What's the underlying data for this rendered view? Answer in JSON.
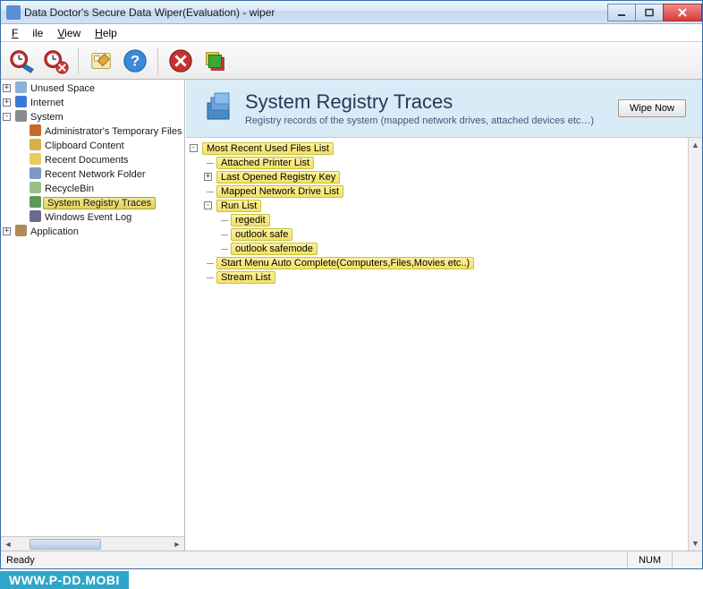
{
  "window": {
    "title": "Data Doctor's Secure Data Wiper(Evaluation) - wiper"
  },
  "menu": {
    "file": "File",
    "view": "View",
    "help": "Help"
  },
  "toolbar": {
    "schedule_add": "schedule-add",
    "schedule_remove": "schedule-remove",
    "settings": "settings",
    "help": "help",
    "stop": "stop",
    "wipe": "wipe"
  },
  "tree": {
    "unused_space": "Unused Space",
    "internet": "Internet",
    "system": "System",
    "system_children": {
      "admin_temp": "Administrator's Temporary Files",
      "clipboard": "Clipboard Content",
      "recent_docs": "Recent Documents",
      "recent_network": "Recent Network Folder",
      "recyclebin": "RecycleBin",
      "registry_traces": "System Registry Traces",
      "event_log": "Windows Event Log"
    },
    "application": "Application"
  },
  "banner": {
    "title": "System Registry Traces",
    "desc": "Registry records of the system (mapped network drives, attached devices etc…)",
    "button": "Wipe Now"
  },
  "detail": {
    "most_recent": "Most Recent Used Files List",
    "attached_printer": "Attached Printer List",
    "last_opened": "Last Opened Registry Key",
    "mapped_drive": "Mapped Network Drive List",
    "run_list": "Run List",
    "run_items": {
      "regedit": "regedit",
      "outlook_safe": "outlook safe",
      "outlook_safemode": "outlook safemode"
    },
    "start_menu": "Start Menu Auto Complete(Computers,Files,Movies etc..)",
    "stream_list": "Stream List"
  },
  "status": {
    "ready": "Ready",
    "num": "NUM"
  },
  "watermark": "WWW.P-DD.MOBI"
}
